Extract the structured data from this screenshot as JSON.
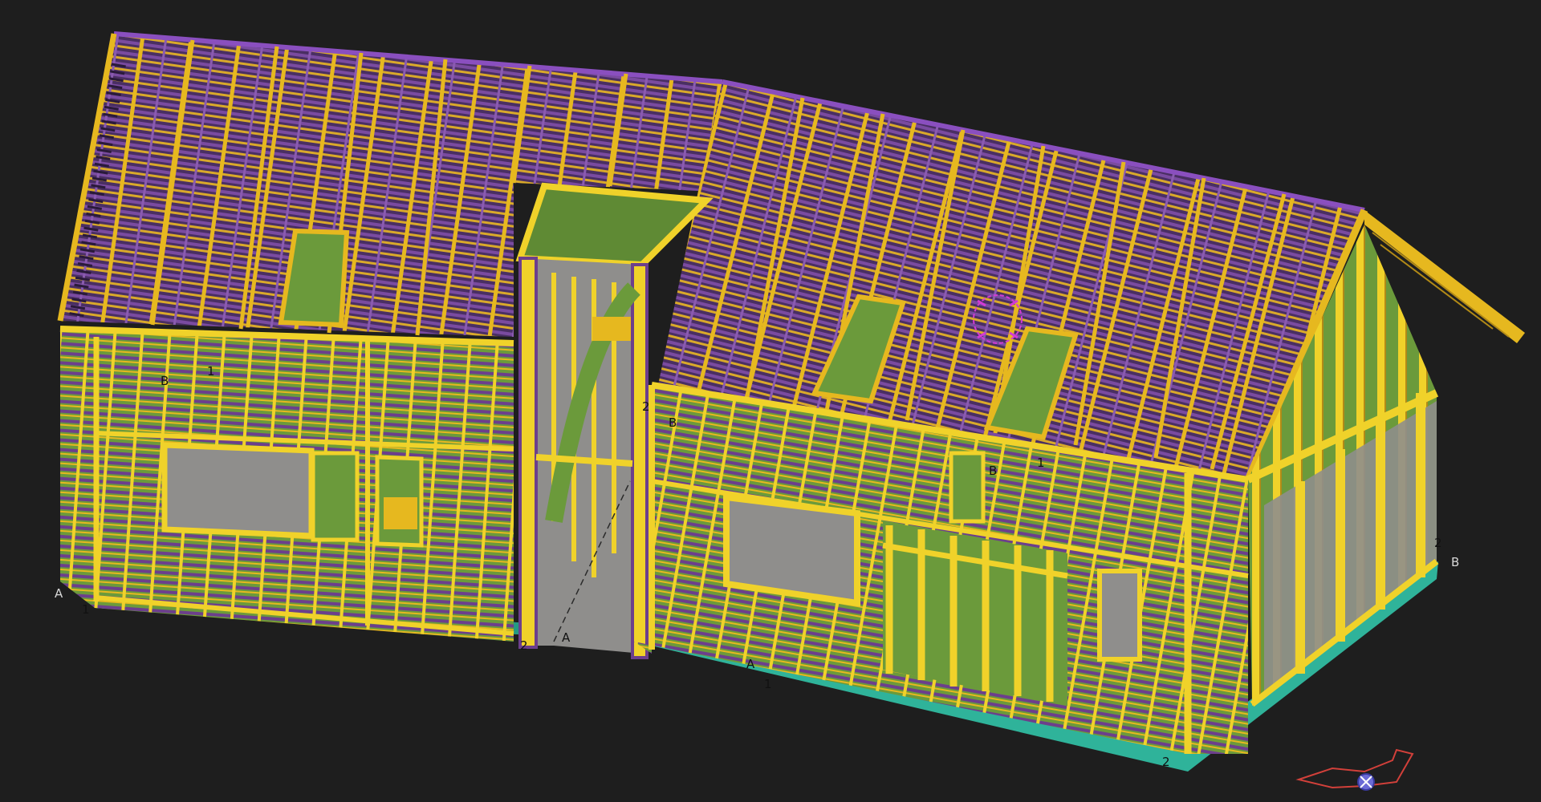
{
  "viewport": {
    "background": "#1e1e1e"
  },
  "colors": {
    "timber_yellow": "#e6b81f",
    "timber_stud": "#f0d22a",
    "batten_purple": "#6c3f8c",
    "sheathing_green": "#6b9a3b",
    "slab_teal": "#2fb39a",
    "floor_grey": "#8f8e8c",
    "snap_magenta": "#d23bd6",
    "gizmo_red": "#d2403a"
  },
  "axis_labels": {
    "a_left": "A",
    "one_left": "1",
    "b_wall_left": "B",
    "one_wall_left": "1",
    "two_tower": "2",
    "b_tower": "B",
    "two_tower_bottom": "2",
    "a_tower_bottom": "A",
    "a_front": "A",
    "one_front": "1",
    "b_mid": "B",
    "one_mid": "1",
    "two_bottom": "2",
    "two_right": "2",
    "b_right": "B"
  },
  "icons": {
    "snap_marker": "snap-target-icon",
    "orientation_gizmo": "view-orientation-gizmo-icon"
  }
}
